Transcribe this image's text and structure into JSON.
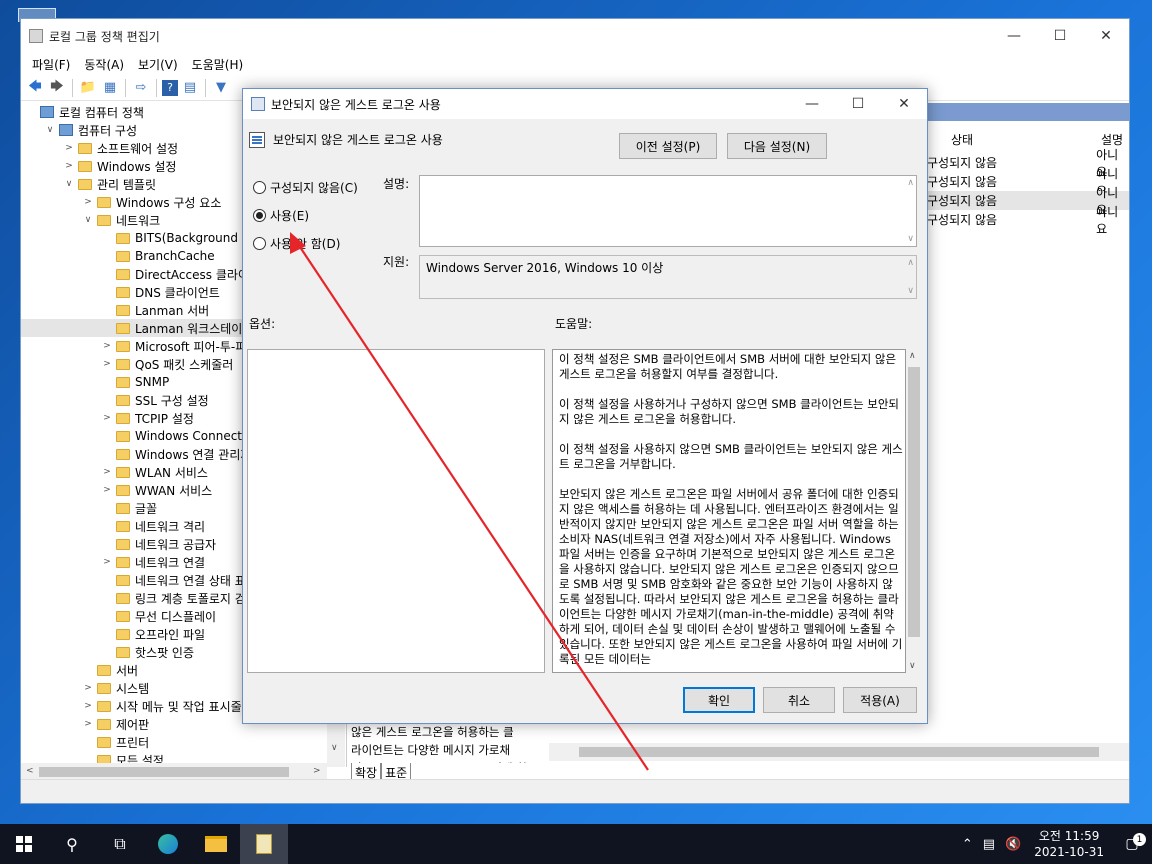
{
  "main_window": {
    "title": "로컬 그룹 정책 편집기",
    "menu": [
      "파일(F)",
      "동작(A)",
      "보기(V)",
      "도움말(H)"
    ]
  },
  "tree": [
    {
      "label": "로컬 컴퓨터 정책",
      "level": 0,
      "exp": "",
      "icon": "pc"
    },
    {
      "label": "컴퓨터 구성",
      "level": 1,
      "exp": "v",
      "icon": "pc"
    },
    {
      "label": "소프트웨어 설정",
      "level": 2,
      "exp": ">",
      "icon": "folder"
    },
    {
      "label": "Windows 설정",
      "level": 2,
      "exp": ">",
      "icon": "folder"
    },
    {
      "label": "관리 템플릿",
      "level": 2,
      "exp": "v",
      "icon": "folder"
    },
    {
      "label": "Windows 구성 요소",
      "level": 3,
      "exp": ">",
      "icon": "folder"
    },
    {
      "label": "네트워크",
      "level": 3,
      "exp": "v",
      "icon": "folder"
    },
    {
      "label": "BITS(Background Intell",
      "level": 4,
      "exp": "",
      "icon": "folder"
    },
    {
      "label": "BranchCache",
      "level": 4,
      "exp": "",
      "icon": "folder"
    },
    {
      "label": "DirectAccess 클라이언",
      "level": 4,
      "exp": "",
      "icon": "folder"
    },
    {
      "label": "DNS 클라이언트",
      "level": 4,
      "exp": "",
      "icon": "folder"
    },
    {
      "label": "Lanman 서버",
      "level": 4,
      "exp": "",
      "icon": "folder"
    },
    {
      "label": "Lanman 워크스테이션",
      "level": 4,
      "exp": "",
      "icon": "folder",
      "selected": true
    },
    {
      "label": "Microsoft 피어-투-피어",
      "level": 4,
      "exp": ">",
      "icon": "folder"
    },
    {
      "label": "QoS 패킷 스케줄러",
      "level": 4,
      "exp": ">",
      "icon": "folder"
    },
    {
      "label": "SNMP",
      "level": 4,
      "exp": "",
      "icon": "folder"
    },
    {
      "label": "SSL 구성 설정",
      "level": 4,
      "exp": "",
      "icon": "folder"
    },
    {
      "label": "TCPIP 설정",
      "level": 4,
      "exp": ">",
      "icon": "folder"
    },
    {
      "label": "Windows Connect Now",
      "level": 4,
      "exp": "",
      "icon": "folder"
    },
    {
      "label": "Windows 연결 관리자",
      "level": 4,
      "exp": "",
      "icon": "folder"
    },
    {
      "label": "WLAN 서비스",
      "level": 4,
      "exp": ">",
      "icon": "folder"
    },
    {
      "label": "WWAN 서비스",
      "level": 4,
      "exp": ">",
      "icon": "folder"
    },
    {
      "label": "글꼴",
      "level": 4,
      "exp": "",
      "icon": "folder"
    },
    {
      "label": "네트워크 격리",
      "level": 4,
      "exp": "",
      "icon": "folder"
    },
    {
      "label": "네트워크 공급자",
      "level": 4,
      "exp": "",
      "icon": "folder"
    },
    {
      "label": "네트워크 연결",
      "level": 4,
      "exp": ">",
      "icon": "folder"
    },
    {
      "label": "네트워크 연결 상태 표",
      "level": 4,
      "exp": "",
      "icon": "folder"
    },
    {
      "label": "링크 계층 토폴로지 검",
      "level": 4,
      "exp": "",
      "icon": "folder"
    },
    {
      "label": "무선 디스플레이",
      "level": 4,
      "exp": "",
      "icon": "folder"
    },
    {
      "label": "오프라인 파일",
      "level": 4,
      "exp": "",
      "icon": "folder"
    },
    {
      "label": "핫스팟 인증",
      "level": 4,
      "exp": "",
      "icon": "folder"
    },
    {
      "label": "서버",
      "level": 3,
      "exp": "",
      "icon": "folder"
    },
    {
      "label": "시스템",
      "level": 3,
      "exp": ">",
      "icon": "folder"
    },
    {
      "label": "시작 메뉴 및 작업 표시줄",
      "level": 3,
      "exp": ">",
      "icon": "folder"
    },
    {
      "label": "제어판",
      "level": 3,
      "exp": ">",
      "icon": "folder"
    },
    {
      "label": "프린터",
      "level": 3,
      "exp": "",
      "icon": "folder"
    },
    {
      "label": "모든 설정",
      "level": 3,
      "exp": "",
      "icon": "folder"
    }
  ],
  "right_pane": {
    "col_state": "상태",
    "col_comment": "설명",
    "rows": [
      {
        "state": "구성되지 않음",
        "comment": "아니요"
      },
      {
        "state": "구성되지 않음",
        "comment": "아니요"
      },
      {
        "state": "구성되지 않음",
        "comment": "아니요"
      },
      {
        "state": "구성되지 않음",
        "comment": "아니요"
      }
    ],
    "desc_snippet": "않은 게스트 로그온을 허용하는 클\n라이언트는 다양한 메시지 가로채\n기(man-in-the-middle) 공격에 취",
    "tabs": [
      "확장",
      "표준"
    ]
  },
  "dialog": {
    "title": "보안되지 않은 게스트 로그온 사용",
    "policy_name": "보안되지 않은 게스트 로그온 사용",
    "prev_button": "이전 설정(P)",
    "next_button": "다음 설정(N)",
    "radio_not_configured": "구성되지 않음(C)",
    "radio_enabled": "사용(E)",
    "radio_disabled": "사용 안 함(D)",
    "comment_label": "설명:",
    "supported_label": "지원:",
    "supported_value": "Windows Server 2016, Windows 10 이상",
    "options_label": "옵션:",
    "help_label": "도움말:",
    "help_text": "이 정책 설정은 SMB 클라이언트에서 SMB 서버에 대한 보안되지 않은 게스트 로그온을 허용할지 여부를 결정합니다.\n\n이 정책 설정을 사용하거나 구성하지 않으면 SMB 클라이언트는 보안되지 않은 게스트 로그온을 허용합니다.\n\n이 정책 설정을 사용하지 않으면 SMB 클라이언트는 보안되지 않은 게스트 로그온을 거부합니다.\n\n보안되지 않은 게스트 로그온은 파일 서버에서 공유 폴더에 대한 인증되지 않은 액세스를 허용하는 데 사용됩니다. 엔터프라이즈 환경에서는 일반적이지 않지만 보안되지 않은 게스트 로그온은 파일 서버 역할을 하는 소비자 NAS(네트워크 연결 저장소)에서 자주 사용됩니다. Windows 파일 서버는 인증을 요구하며 기본적으로 보안되지 않은 게스트 로그온을 사용하지 않습니다. 보안되지 않은 게스트 로그온은 인증되지 않으므로 SMB 서명 및 SMB 암호화와 같은 중요한 보안 기능이 사용하지 않도록 설정됩니다. 따라서 보안되지 않은 게스트 로그온을 허용하는 클라이언트는 다양한 메시지 가로채기(man-in-the-middle) 공격에 취약하게 되어, 데이터 손실 및 데이터 손상이 발생하고 맬웨어에 노출될 수 있습니다. 또한 보안되지 않은 게스트 로그온을 사용하여 파일 서버에 기록된 모든 데이터는",
    "ok_button": "확인",
    "cancel_button": "취소",
    "apply_button": "적용(A)"
  },
  "taskbar": {
    "time": "오전 11:59",
    "date": "2021-10-31",
    "notification_count": "1"
  }
}
